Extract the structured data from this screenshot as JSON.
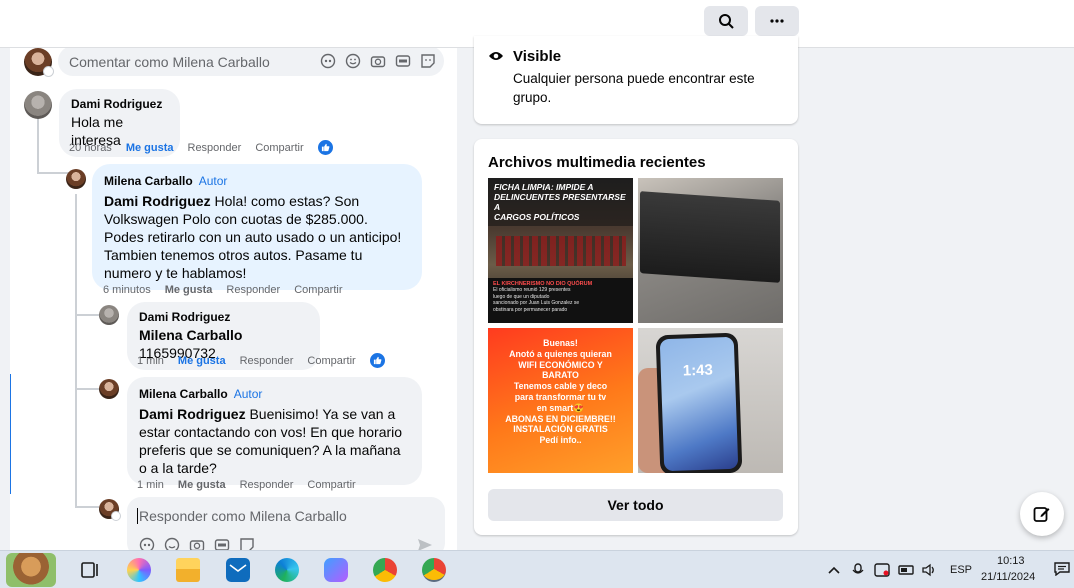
{
  "topbar": {
    "search_icon": "search-icon",
    "more_icon": "more-horizontal-icon"
  },
  "comment_box": {
    "placeholder": "Comentar como Milena Carballo"
  },
  "comments": [
    {
      "author": "Dami Rodriguez",
      "text": "Hola me interesa",
      "time": "20 horas",
      "like_label": "Me gusta",
      "reply_label": "Responder",
      "share_label": "Compartir",
      "liked": true
    },
    {
      "author": "Milena Carballo",
      "badge": "Autor",
      "mention": "Dami Rodriguez",
      "text": " Hola! como estas? Son Volkswagen Polo con cuotas de $285.000. Podes retirarlo con un auto usado o un anticipo! Tambien tenemos otros autos. Pasame tu numero y te hablamos!",
      "time": "6 minutos",
      "like_label": "Me gusta",
      "reply_label": "Responder",
      "share_label": "Compartir"
    },
    {
      "author": "Dami Rodriguez",
      "mention": "Milena Carballo",
      "text": " 1165990732",
      "time": "1 min",
      "like_label": "Me gusta",
      "reply_label": "Responder",
      "share_label": "Compartir",
      "liked": true
    },
    {
      "author": "Milena Carballo",
      "badge": "Autor",
      "mention": "Dami Rodriguez",
      "text": " Buenisimo! Ya se van a estar contactando con vos! En que horario preferis que se comuniquen? A la mañana o a la tarde?",
      "time": "1 min",
      "like_label": "Me gusta",
      "reply_label": "Responder",
      "share_label": "Compartir"
    }
  ],
  "reply_box": {
    "placeholder": "Responder como Milena Carballo"
  },
  "visibility": {
    "title": "Visible",
    "description": "Cualquier persona puede encontrar este grupo."
  },
  "media": {
    "title": "Archivos multimedia recientes",
    "see_all": "Ver todo",
    "items": [
      {
        "lines": [
          "FICHA LIMPIA: IMPIDE A",
          "DELINCUENTES PRESENTARSE A",
          "CARGOS POLÍTICOS"
        ],
        "caption": [
          "EL KIRCHNERISMO NO DIO QUÓRUM",
          "El oficialismo reunió 129 presentes",
          "luego de que un diputado",
          "sancionado por Juan Luis Gonzalez se",
          "obstinara por permanecer parado"
        ]
      },
      {
        "lines": []
      },
      {
        "lines": [
          "Buenas!",
          "Anotó a quienes quieran",
          "WIFI ECONÓMICO Y",
          "BARATO",
          "Tenemos cable y deco",
          "para transformar tu tv",
          "en smart😍",
          "ABONAS EN DICIEMBRE!!",
          "INSTALACIÓN GRATIS",
          "Pedí info.."
        ]
      },
      {
        "lines": [
          "1:43"
        ]
      }
    ]
  },
  "taskbar": {
    "lang": "ESP",
    "time": "10:13",
    "date": "21/11/2024"
  },
  "colors": {
    "accent": "#1b74e4",
    "author_bubble": "#e7f3ff",
    "bubble": "#f0f2f5"
  }
}
